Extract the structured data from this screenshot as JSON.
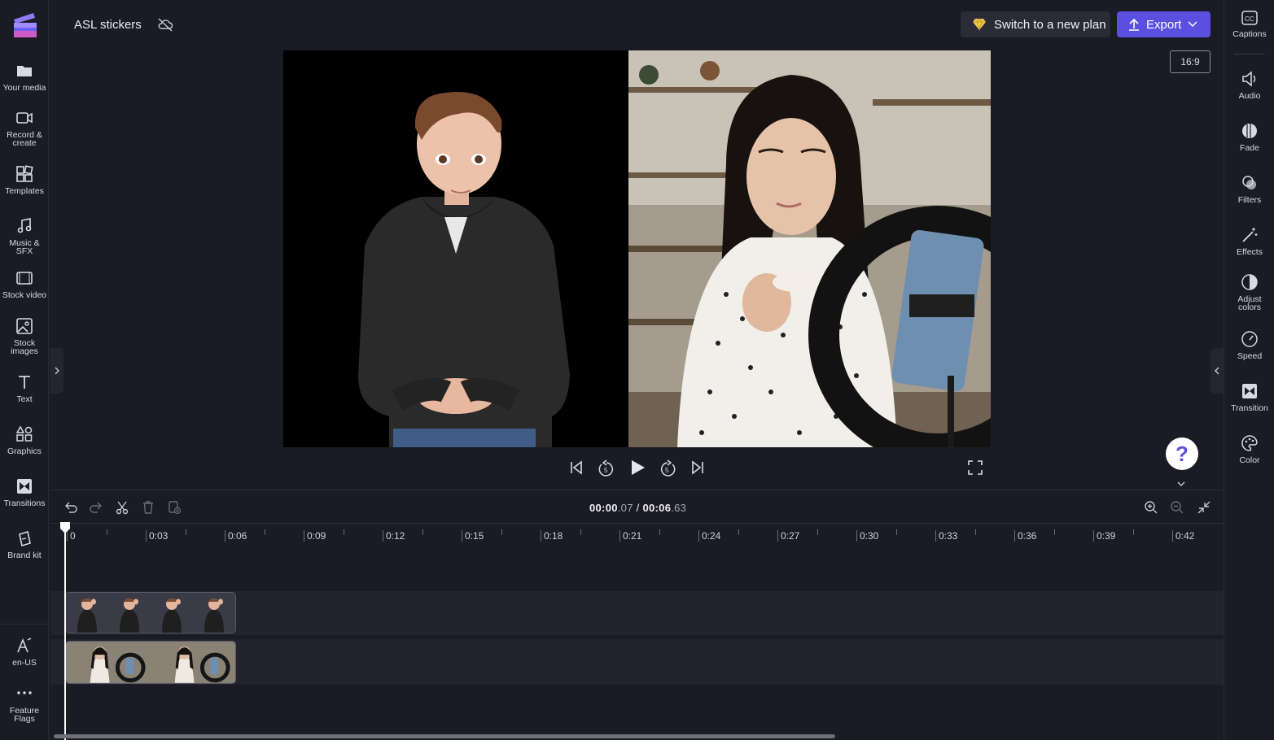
{
  "header": {
    "project_title": "ASL stickers",
    "switch_plan_label": "Switch to a new plan",
    "export_label": "Export",
    "aspect_ratio": "16:9"
  },
  "left_sidebar": {
    "items": [
      {
        "label": "Your media",
        "icon": "folder-icon"
      },
      {
        "label": "Record & create",
        "icon": "camera-icon"
      },
      {
        "label": "Templates",
        "icon": "templates-icon"
      },
      {
        "label": "Music & SFX",
        "icon": "music-icon"
      },
      {
        "label": "Stock video",
        "icon": "film-icon"
      },
      {
        "label": "Stock images",
        "icon": "image-icon"
      },
      {
        "label": "Text",
        "icon": "text-icon"
      },
      {
        "label": "Graphics",
        "icon": "shapes-icon"
      },
      {
        "label": "Transitions",
        "icon": "transition-icon"
      },
      {
        "label": "Brand kit",
        "icon": "brand-icon"
      },
      {
        "label": "en-US",
        "icon": "language-icon"
      },
      {
        "label": "Feature Flags",
        "icon": "more-icon"
      }
    ]
  },
  "right_sidebar": {
    "items": [
      {
        "label": "Captions",
        "icon": "captions-icon"
      },
      {
        "label": "Audio",
        "icon": "speaker-icon"
      },
      {
        "label": "Fade",
        "icon": "fade-icon"
      },
      {
        "label": "Filters",
        "icon": "filters-icon"
      },
      {
        "label": "Effects",
        "icon": "magic-wand-icon"
      },
      {
        "label": "Adjust colors",
        "icon": "contrast-icon"
      },
      {
        "label": "Speed",
        "icon": "speedometer-icon"
      },
      {
        "label": "Transition",
        "icon": "transition-icon"
      },
      {
        "label": "Color",
        "icon": "palette-icon"
      }
    ]
  },
  "playback": {
    "current_time_main": "00:00",
    "current_time_frac": ".07",
    "separator": " / ",
    "total_time_main": "00:06",
    "total_time_frac": ".63"
  },
  "timeline": {
    "ticks": [
      "0",
      "0:03",
      "0:06",
      "0:09",
      "0:12",
      "0:15",
      "0:18",
      "0:21",
      "0:24",
      "0:27",
      "0:30",
      "0:33",
      "0:36",
      "0:39",
      "0:42"
    ]
  },
  "help": {
    "label": "?"
  },
  "colors": {
    "accent": "#5b4fe0",
    "background": "#1b1b26",
    "track": "#23232f"
  }
}
